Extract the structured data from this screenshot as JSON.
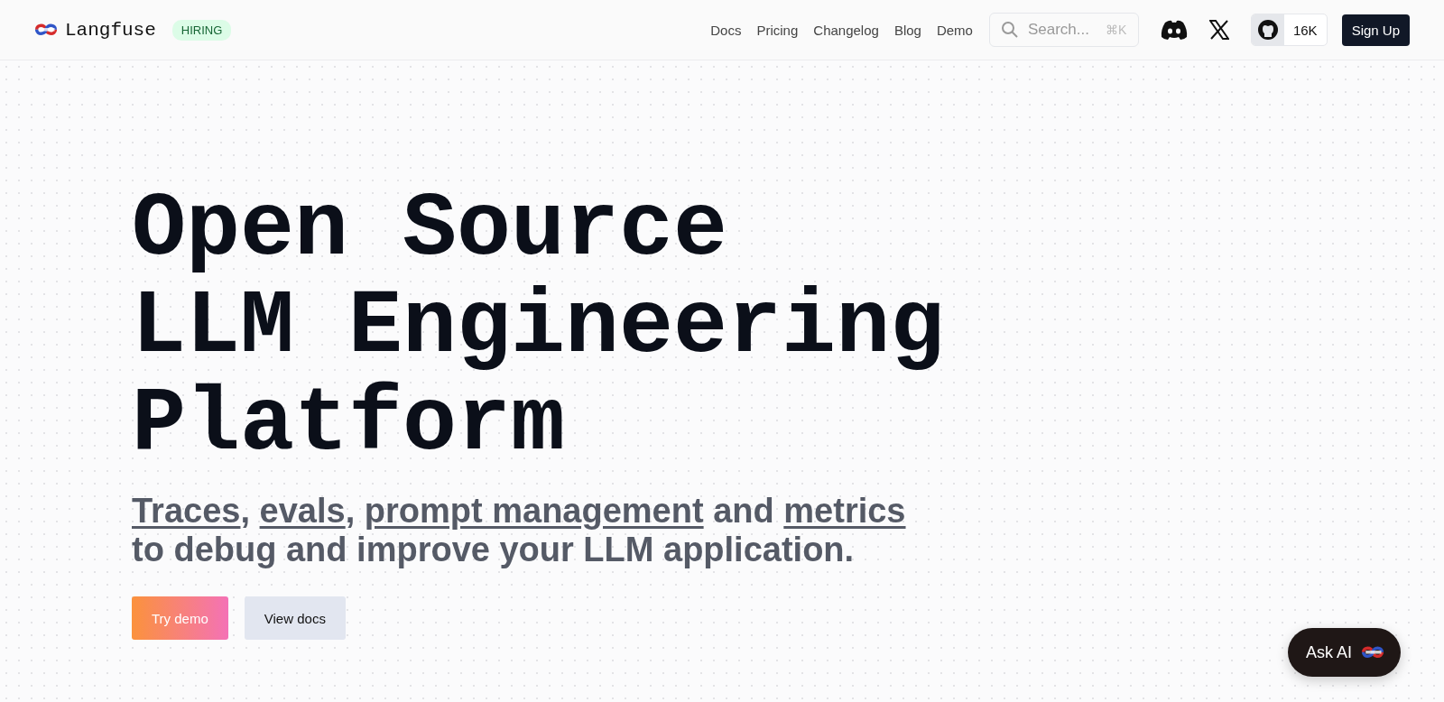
{
  "header": {
    "brand": "Langfuse",
    "badge": "HIRING",
    "nav": [
      "Docs",
      "Pricing",
      "Changelog",
      "Blog",
      "Demo"
    ],
    "search": {
      "placeholder": "Search...",
      "shortcut": "⌘K"
    },
    "github_stars": "16K",
    "signup": "Sign Up"
  },
  "hero": {
    "title_lines": [
      "Open Source",
      "LLM Engineering",
      "Platform"
    ],
    "subtitle": [
      {
        "text": "Traces",
        "kind": "link"
      },
      {
        "text": ", ",
        "kind": "text"
      },
      {
        "text": "evals",
        "kind": "link"
      },
      {
        "text": ", ",
        "kind": "text"
      },
      {
        "text": "prompt management",
        "kind": "link"
      },
      {
        "text": " and ",
        "kind": "text"
      },
      {
        "text": "metrics",
        "kind": "link"
      },
      {
        "text": " to debug and improve your LLM application.",
        "kind": "text"
      }
    ],
    "buttons": [
      {
        "label": "Try demo",
        "kind": "primary"
      },
      {
        "label": "View docs",
        "kind": "secondary"
      }
    ]
  },
  "ask_ai": "Ask AI"
}
